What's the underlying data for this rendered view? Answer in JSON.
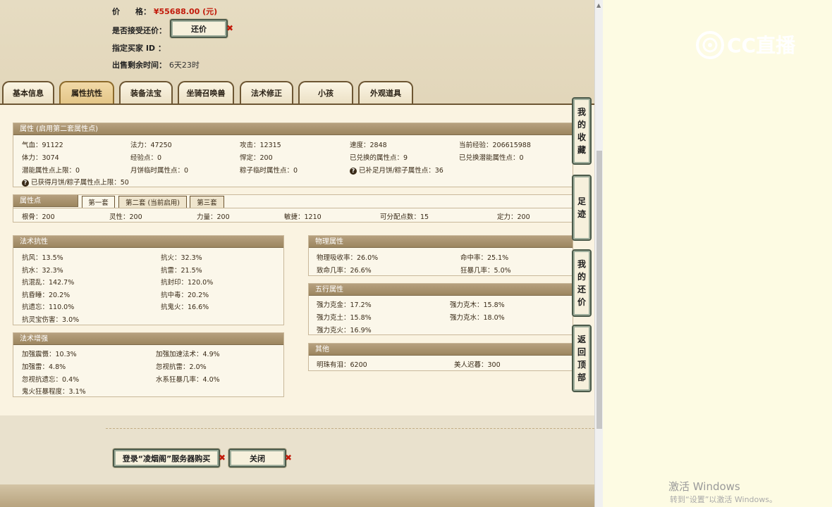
{
  "header": {
    "price_label": "价　　格：",
    "price_value": "¥55688.00 (元)",
    "bargain_label": "是否接受还价：",
    "bargain_button": "还价",
    "buyer_label": "指定买家 ID ：",
    "time_label": "出售剩余时间：",
    "time_value": "6天23时"
  },
  "tabs": [
    "基本信息",
    "属性抗性",
    "装备法宝",
    "坐骑召唤兽",
    "法术修正",
    "小孩",
    "外观道具"
  ],
  "attr": {
    "title": "属性 (启用第二套属性点)",
    "rows": [
      [
        "气血：91122",
        "法力：47250",
        "攻击：12315",
        "速度：2848",
        "当前经验：206615988"
      ],
      [
        "体力：3074",
        "经验点：0",
        "悍定：200",
        "已兑换的属性点：9",
        "已兑换潜能属性点：0"
      ],
      [
        "潜能属性点上限：0",
        "月饼临时属性点：0",
        "粽子临时属性点：0",
        "已补足月饼/粽子属性点：36"
      ],
      [
        "已获得月饼/粽子属性点上限：50"
      ]
    ]
  },
  "points": {
    "title": "属性点",
    "subtabs": [
      "第一套",
      "第二套 (当前启用)",
      "第三套"
    ],
    "values": [
      "根骨：200",
      "灵性：200",
      "力量：200",
      "敏捷：1210",
      "可分配点数：15",
      "定力：200"
    ]
  },
  "resist": {
    "title": "法术抗性",
    "items": [
      "抗风：13.5%",
      "抗火：32.3%",
      "抗水：32.3%",
      "抗雷：21.5%",
      "抗混乱：142.7%",
      "抗封印：120.0%",
      "抗昏睡：20.2%",
      "抗中毒：20.2%",
      "抗遗忘：110.0%",
      "抗鬼火：16.6%",
      "抗灵宝伤害：3.0%"
    ]
  },
  "enhance": {
    "title": "法术增强",
    "items": [
      "加强震慑：10.3%",
      "加强加速法术：4.9%",
      "加强雷：4.8%",
      "忽视抗雷：2.0%",
      "忽视抗遗忘：0.4%",
      "水系狂暴几率：4.0%",
      "鬼火狂暴程度：3.1%"
    ]
  },
  "physical": {
    "title": "物理属性",
    "items": [
      "物理吸收率：26.0%",
      "命中率：25.1%",
      "致命几率：26.6%",
      "狂暴几率：5.0%"
    ]
  },
  "five": {
    "title": "五行属性",
    "items": [
      "强力克金：17.2%",
      "强力克木：15.8%",
      "强力克土：15.8%",
      "强力克水：18.0%",
      "强力克火：16.9%"
    ]
  },
  "other": {
    "title": "其他",
    "items": [
      "明珠有泪：6200",
      "美人迟暮：300"
    ]
  },
  "side": [
    {
      "name": "favorites",
      "chars": [
        "我",
        "的",
        "收",
        "藏"
      ]
    },
    {
      "name": "footprint",
      "chars": [
        "足",
        "迹"
      ]
    },
    {
      "name": "my-bargain",
      "chars": [
        "我",
        "的",
        "还",
        "价"
      ]
    },
    {
      "name": "back-top",
      "chars": [
        "返",
        "回",
        "顶",
        "部"
      ]
    }
  ],
  "footer": {
    "buy_button": "登录“凌烟阁”服务器购买",
    "close_button": "关闭"
  },
  "watermark": {
    "line1": "激活 Windows",
    "line2": "转到“设置”以激活 Windows。"
  },
  "logo_text": "CC直播"
}
